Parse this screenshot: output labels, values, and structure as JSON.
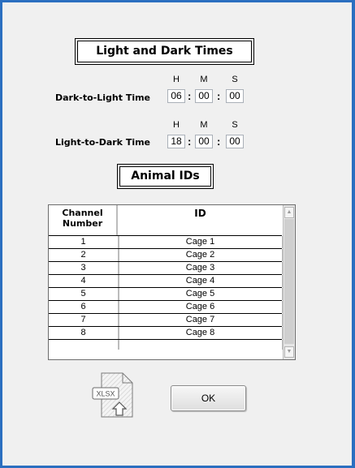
{
  "sections": {
    "light_dark_title": "Light and Dark Times",
    "animal_ids_title": "Animal IDs"
  },
  "times": {
    "units": {
      "h": "H",
      "m": "M",
      "s": "S"
    },
    "separator": ":",
    "dark_to_light": {
      "label": "Dark-to-Light Time",
      "h": "06",
      "m": "00",
      "s": "00"
    },
    "light_to_dark": {
      "label": "Light-to-Dark Time",
      "h": "18",
      "m": "00",
      "s": "00"
    }
  },
  "table": {
    "headers": {
      "channel_line1": "Channel",
      "channel_line2": "Number",
      "id": "ID"
    },
    "rows": [
      {
        "channel": "1",
        "id": "Cage 1"
      },
      {
        "channel": "2",
        "id": "Cage 2"
      },
      {
        "channel": "3",
        "id": "Cage 3"
      },
      {
        "channel": "4",
        "id": "Cage 4"
      },
      {
        "channel": "5",
        "id": "Cage 5"
      },
      {
        "channel": "6",
        "id": "Cage 6"
      },
      {
        "channel": "7",
        "id": "Cage 7"
      },
      {
        "channel": "8",
        "id": "Cage 8"
      }
    ]
  },
  "xlsx_button": {
    "icon": "xlsx-file-import-icon",
    "label": "XLSX"
  },
  "ok_button": {
    "label": "OK"
  },
  "colors": {
    "window_border": "#2b6fc0",
    "background": "#f0f0f0"
  }
}
